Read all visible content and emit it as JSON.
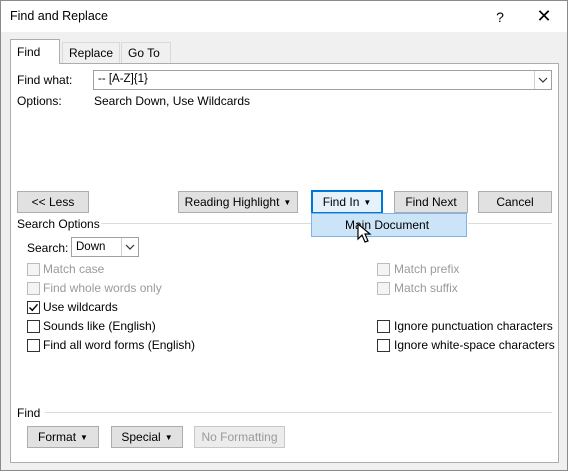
{
  "window": {
    "title": "Find and Replace",
    "help_label": "?",
    "close_label": "✕"
  },
  "tabs": [
    {
      "label": "Find",
      "active": true
    },
    {
      "label": "Replace",
      "active": false
    },
    {
      "label": "Go To",
      "active": false
    }
  ],
  "find": {
    "label": "Find what:",
    "value": "-- [A-Z]{1}",
    "options_label": "Options:",
    "options_value": "Search Down, Use Wildcards"
  },
  "buttons": {
    "less": "<< Less",
    "reading_highlight": "Reading Highlight",
    "find_in": "Find In",
    "find_next": "Find Next",
    "cancel": "Cancel"
  },
  "find_in_menu": {
    "items": [
      "Main Document"
    ]
  },
  "search_options": {
    "title": "Search Options",
    "search_label": "Search:",
    "search_value": "Down",
    "left": [
      {
        "label": "Match case",
        "checked": false,
        "enabled": false
      },
      {
        "label": "Find whole words only",
        "checked": false,
        "enabled": false
      },
      {
        "label": "Use wildcards",
        "checked": true,
        "enabled": true
      },
      {
        "label": "Sounds like (English)",
        "checked": false,
        "enabled": true
      },
      {
        "label": "Find all word forms (English)",
        "checked": false,
        "enabled": true
      }
    ],
    "right": [
      {
        "label": "Match prefix",
        "checked": false,
        "enabled": false
      },
      {
        "label": "Match suffix",
        "checked": false,
        "enabled": false
      },
      {
        "label": "Ignore punctuation characters",
        "checked": false,
        "enabled": true
      },
      {
        "label": "Ignore white-space characters",
        "checked": false,
        "enabled": true
      }
    ]
  },
  "find_section": {
    "title": "Find",
    "format": "Format",
    "special": "Special",
    "no_formatting": "No Formatting"
  },
  "icons": {
    "dropdown": "chevron-down-icon",
    "checkmark": "checkmark-icon",
    "cursor": "mouse-pointer-icon"
  }
}
